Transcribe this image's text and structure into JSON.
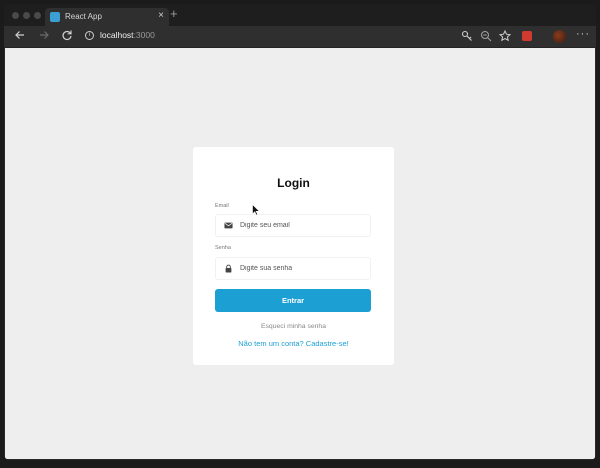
{
  "browser": {
    "tab_title": "React App",
    "tab_close": "×",
    "new_tab": "+",
    "url_host": "localhost",
    "url_port": ":3000",
    "info_glyph": "i",
    "menu_dots": "···",
    "icons": [
      "back-icon",
      "forward-icon",
      "reload-icon",
      "key-icon",
      "zoom-out-icon",
      "star-icon",
      "extension-icon",
      "profile-avatar",
      "more-menu-icon"
    ]
  },
  "login": {
    "title": "Login",
    "email_label": "Email",
    "email_placeholder": "Digite seu email",
    "password_label": "Senha",
    "password_placeholder": "Digite sua senha",
    "submit_label": "Entrar",
    "forgot_label": "Esqueci minha senha",
    "signup_label": "Não tem um conta? Cadastre-se!"
  },
  "colors": {
    "accent": "#1c9fd3",
    "page_background": "#eeeeee",
    "card_background": "#ffffff"
  }
}
